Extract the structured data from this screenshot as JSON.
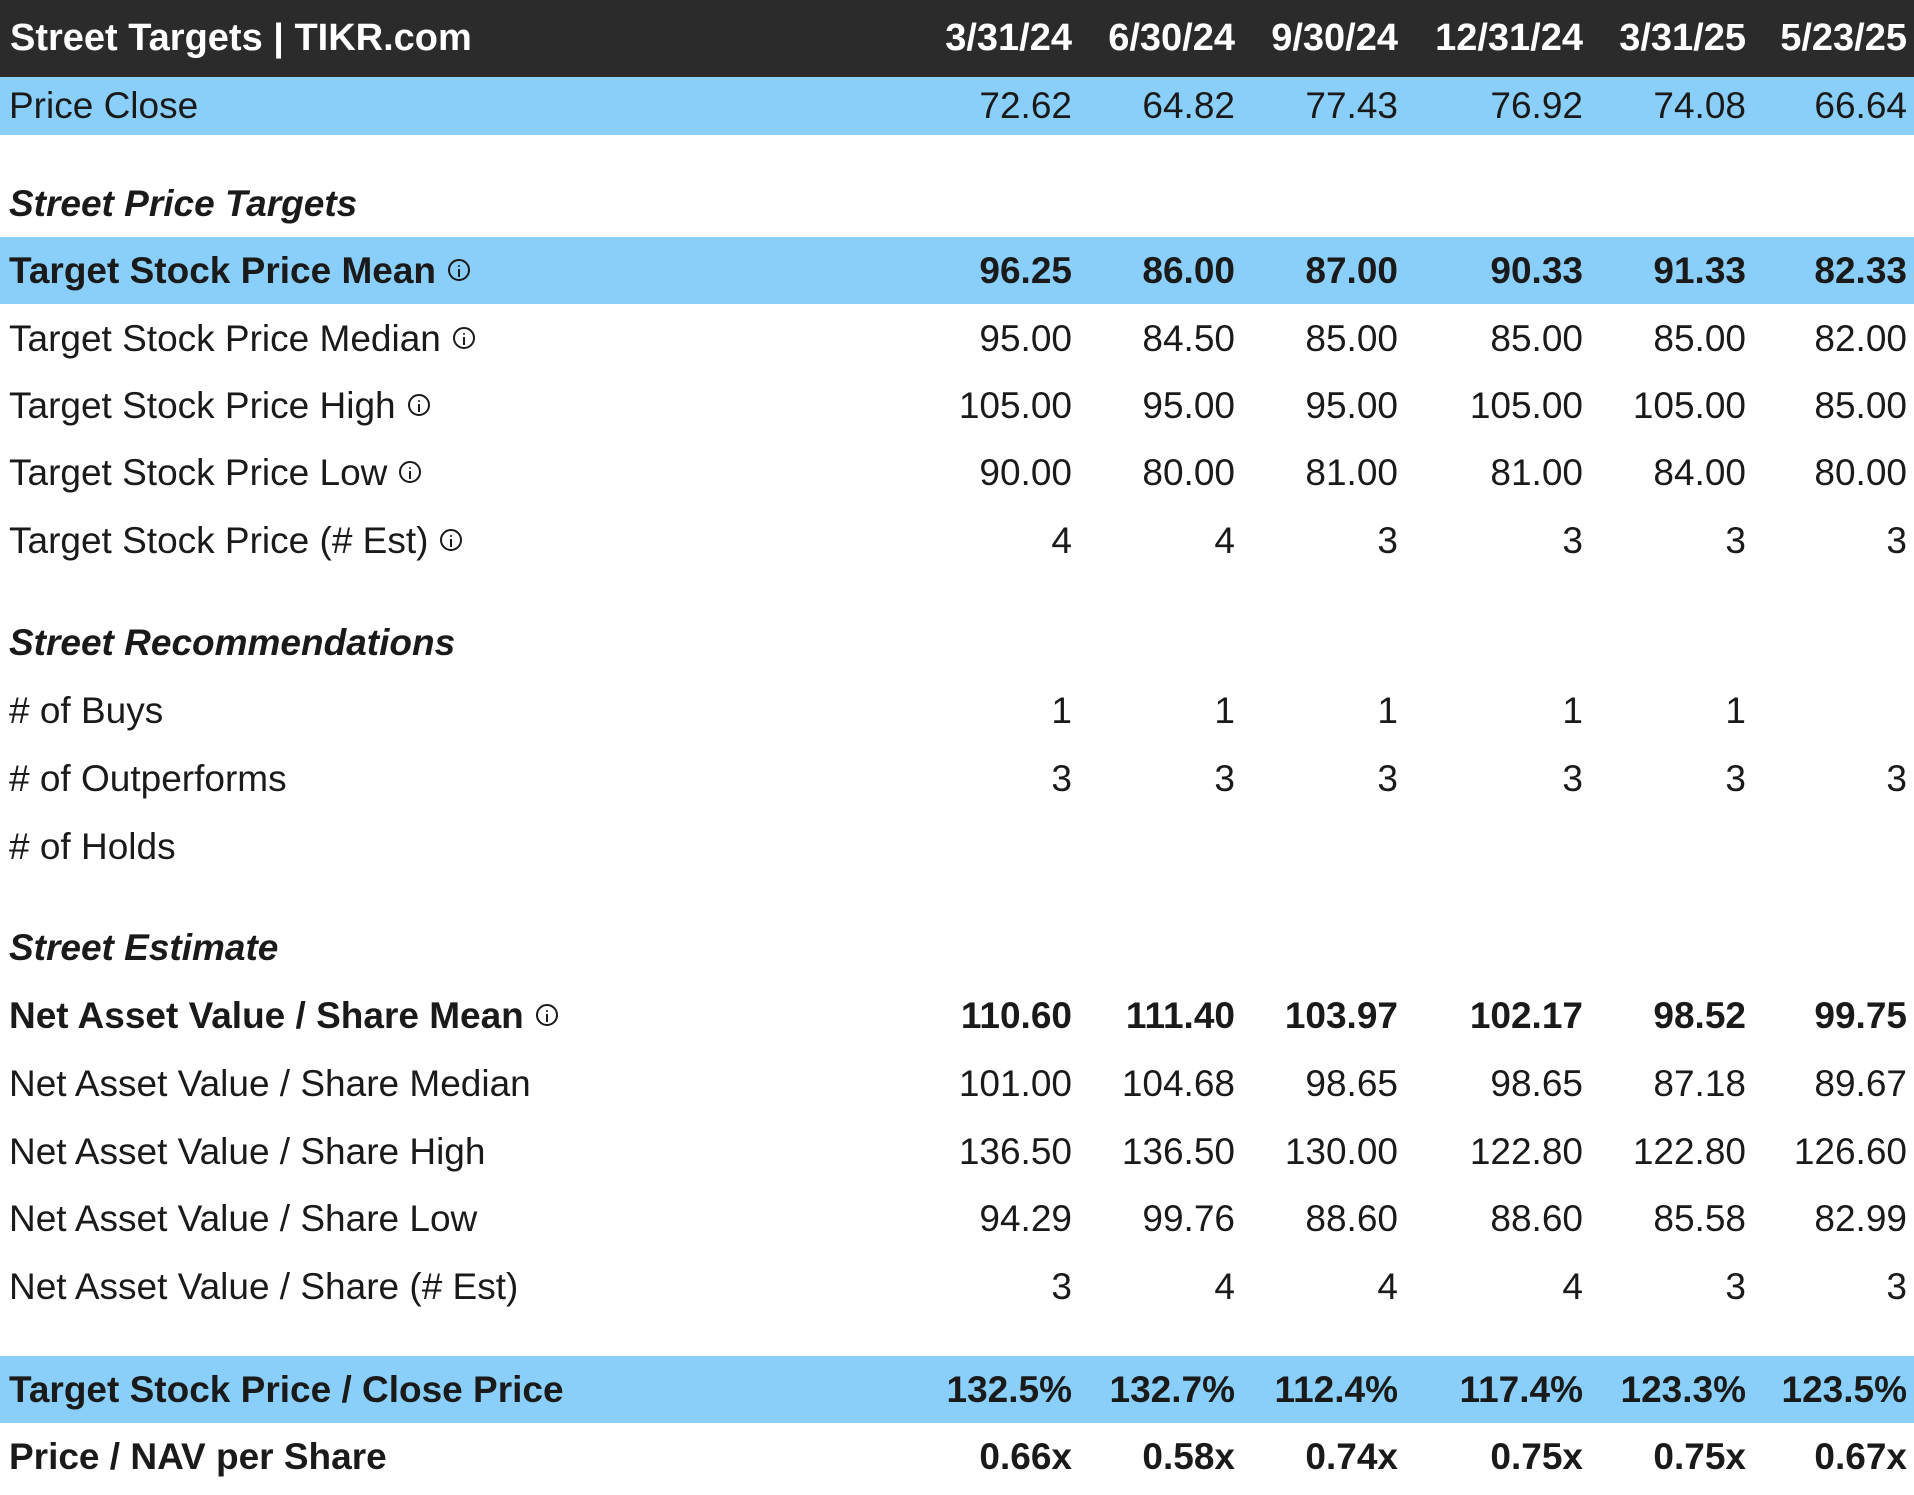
{
  "header": {
    "title": "Street Targets | TIKR.com",
    "dates": [
      "3/31/24",
      "6/30/24",
      "9/30/24",
      "12/31/24",
      "3/31/25",
      "5/23/25"
    ]
  },
  "price_close": {
    "label": "Price Close",
    "values": [
      "72.62",
      "64.82",
      "77.43",
      "76.92",
      "74.08",
      "66.64"
    ]
  },
  "sections": {
    "price_targets": "Street Price Targets",
    "recommendations": "Street Recommendations",
    "estimate": "Street Estimate"
  },
  "rows": {
    "target_mean": {
      "label": "Target Stock Price Mean",
      "values": [
        "96.25",
        "86.00",
        "87.00",
        "90.33",
        "91.33",
        "82.33"
      ]
    },
    "target_median": {
      "label": "Target Stock Price Median",
      "values": [
        "95.00",
        "84.50",
        "85.00",
        "85.00",
        "85.00",
        "82.00"
      ]
    },
    "target_high": {
      "label": "Target Stock Price High",
      "values": [
        "105.00",
        "95.00",
        "95.00",
        "105.00",
        "105.00",
        "85.00"
      ]
    },
    "target_low": {
      "label": "Target Stock Price Low",
      "values": [
        "90.00",
        "80.00",
        "81.00",
        "81.00",
        "84.00",
        "80.00"
      ]
    },
    "target_est": {
      "label": "Target Stock Price (# Est)",
      "values": [
        "4",
        "4",
        "3",
        "3",
        "3",
        "3"
      ]
    },
    "buys": {
      "label": "# of Buys",
      "values": [
        "1",
        "1",
        "1",
        "1",
        "1",
        ""
      ]
    },
    "outperforms": {
      "label": "# of Outperforms",
      "values": [
        "3",
        "3",
        "3",
        "3",
        "3",
        "3"
      ]
    },
    "holds": {
      "label": "# of Holds",
      "values": [
        "",
        "",
        "",
        "",
        "",
        ""
      ]
    },
    "nav_mean": {
      "label": "Net Asset Value / Share Mean",
      "values": [
        "110.60",
        "111.40",
        "103.97",
        "102.17",
        "98.52",
        "99.75"
      ]
    },
    "nav_median": {
      "label": "Net Asset Value / Share Median",
      "values": [
        "101.00",
        "104.68",
        "98.65",
        "98.65",
        "87.18",
        "89.67"
      ]
    },
    "nav_high": {
      "label": "Net Asset Value / Share High",
      "values": [
        "136.50",
        "136.50",
        "130.00",
        "122.80",
        "122.80",
        "126.60"
      ]
    },
    "nav_low": {
      "label": "Net Asset Value / Share Low",
      "values": [
        "94.29",
        "99.76",
        "88.60",
        "88.60",
        "85.58",
        "82.99"
      ]
    },
    "nav_est": {
      "label": "Net Asset Value / Share (# Est)",
      "values": [
        "3",
        "4",
        "4",
        "4",
        "3",
        "3"
      ]
    },
    "target_close": {
      "label": "Target Stock Price / Close Price",
      "values": [
        "132.5%",
        "132.7%",
        "112.4%",
        "117.4%",
        "123.3%",
        "123.5%"
      ]
    },
    "price_nav": {
      "label": "Price / NAV per Share",
      "values": [
        "0.66x",
        "0.58x",
        "0.74x",
        "0.75x",
        "0.75x",
        "0.67x"
      ]
    }
  },
  "colors": {
    "header_bg": "#2b2b2b",
    "highlight": "#89cff9"
  }
}
